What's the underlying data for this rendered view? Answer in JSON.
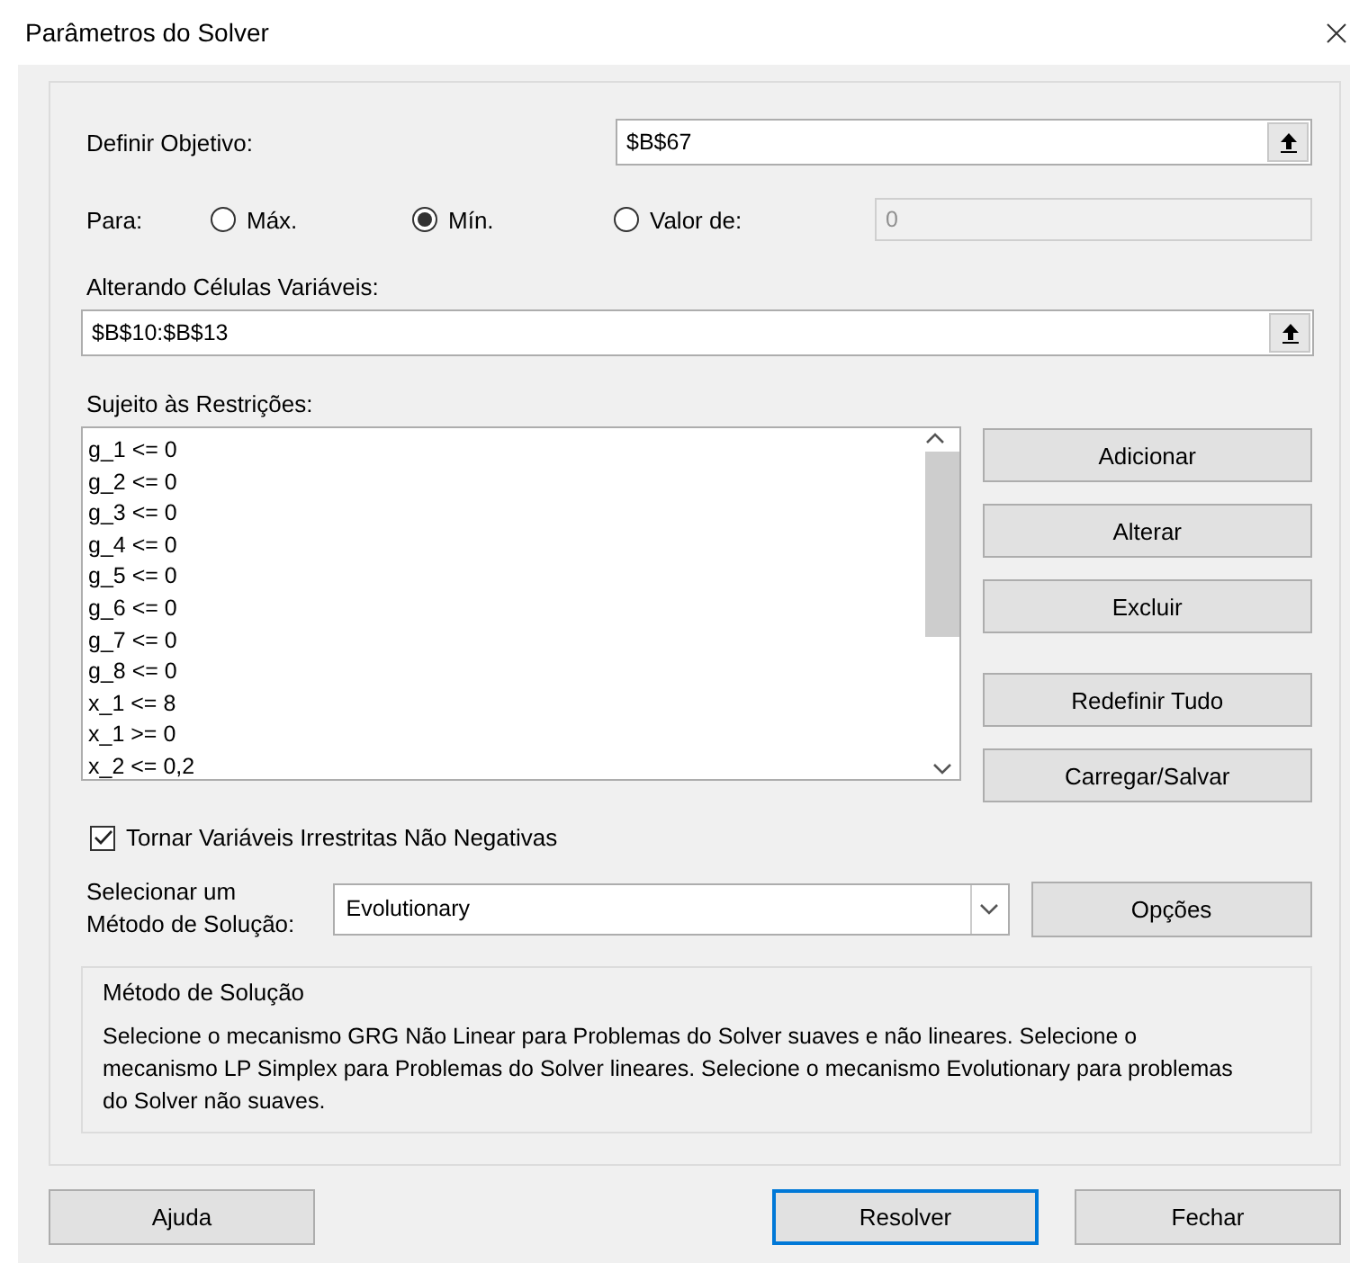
{
  "window": {
    "title": "Parâmetros do Solver"
  },
  "objective": {
    "label": "Definir Objetivo:",
    "value": "$B$67"
  },
  "target": {
    "label": "Para:",
    "options": [
      {
        "label": "Máx.",
        "selected": false
      },
      {
        "label": "Mín.",
        "selected": true
      },
      {
        "label": "Valor de:",
        "selected": false
      }
    ],
    "value_field": {
      "value": "0",
      "disabled": true
    }
  },
  "variables": {
    "label": "Alterando Células Variáveis:",
    "value": "$B$10:$B$13"
  },
  "constraints": {
    "label": "Sujeito às Restrições:",
    "items": [
      "g_1 <= 0",
      "g_2 <= 0",
      "g_3 <= 0",
      "g_4 <= 0",
      "g_5 <= 0",
      "g_6 <= 0",
      "g_7 <= 0",
      "g_8 <= 0",
      "x_1 <= 8",
      "x_1 >= 0",
      "x_2 <= 0,2"
    ]
  },
  "constraint_buttons": [
    "Adicionar",
    "Alterar",
    "Excluir",
    "Redefinir Tudo",
    "Carregar/Salvar"
  ],
  "nonnegative": {
    "label": "Tornar Variáveis Irrestritas Não Negativas",
    "checked": true
  },
  "method": {
    "label": "Selecionar um Método de Solução:",
    "value": "Evolutionary",
    "options_button": "Opções"
  },
  "description": {
    "title": "Método de Solução",
    "text": "Selecione o mecanismo GRG Não Linear para Problemas do Solver suaves e não lineares. Selecione o mecanismo LP Simplex para Problemas do Solver lineares. Selecione o mecanismo Evolutionary para problemas do Solver não suaves."
  },
  "footer_buttons": [
    {
      "label": "Ajuda",
      "kind": "normal"
    },
    {
      "label": "Resolver",
      "kind": "default"
    },
    {
      "label": "Fechar",
      "kind": "normal"
    }
  ]
}
